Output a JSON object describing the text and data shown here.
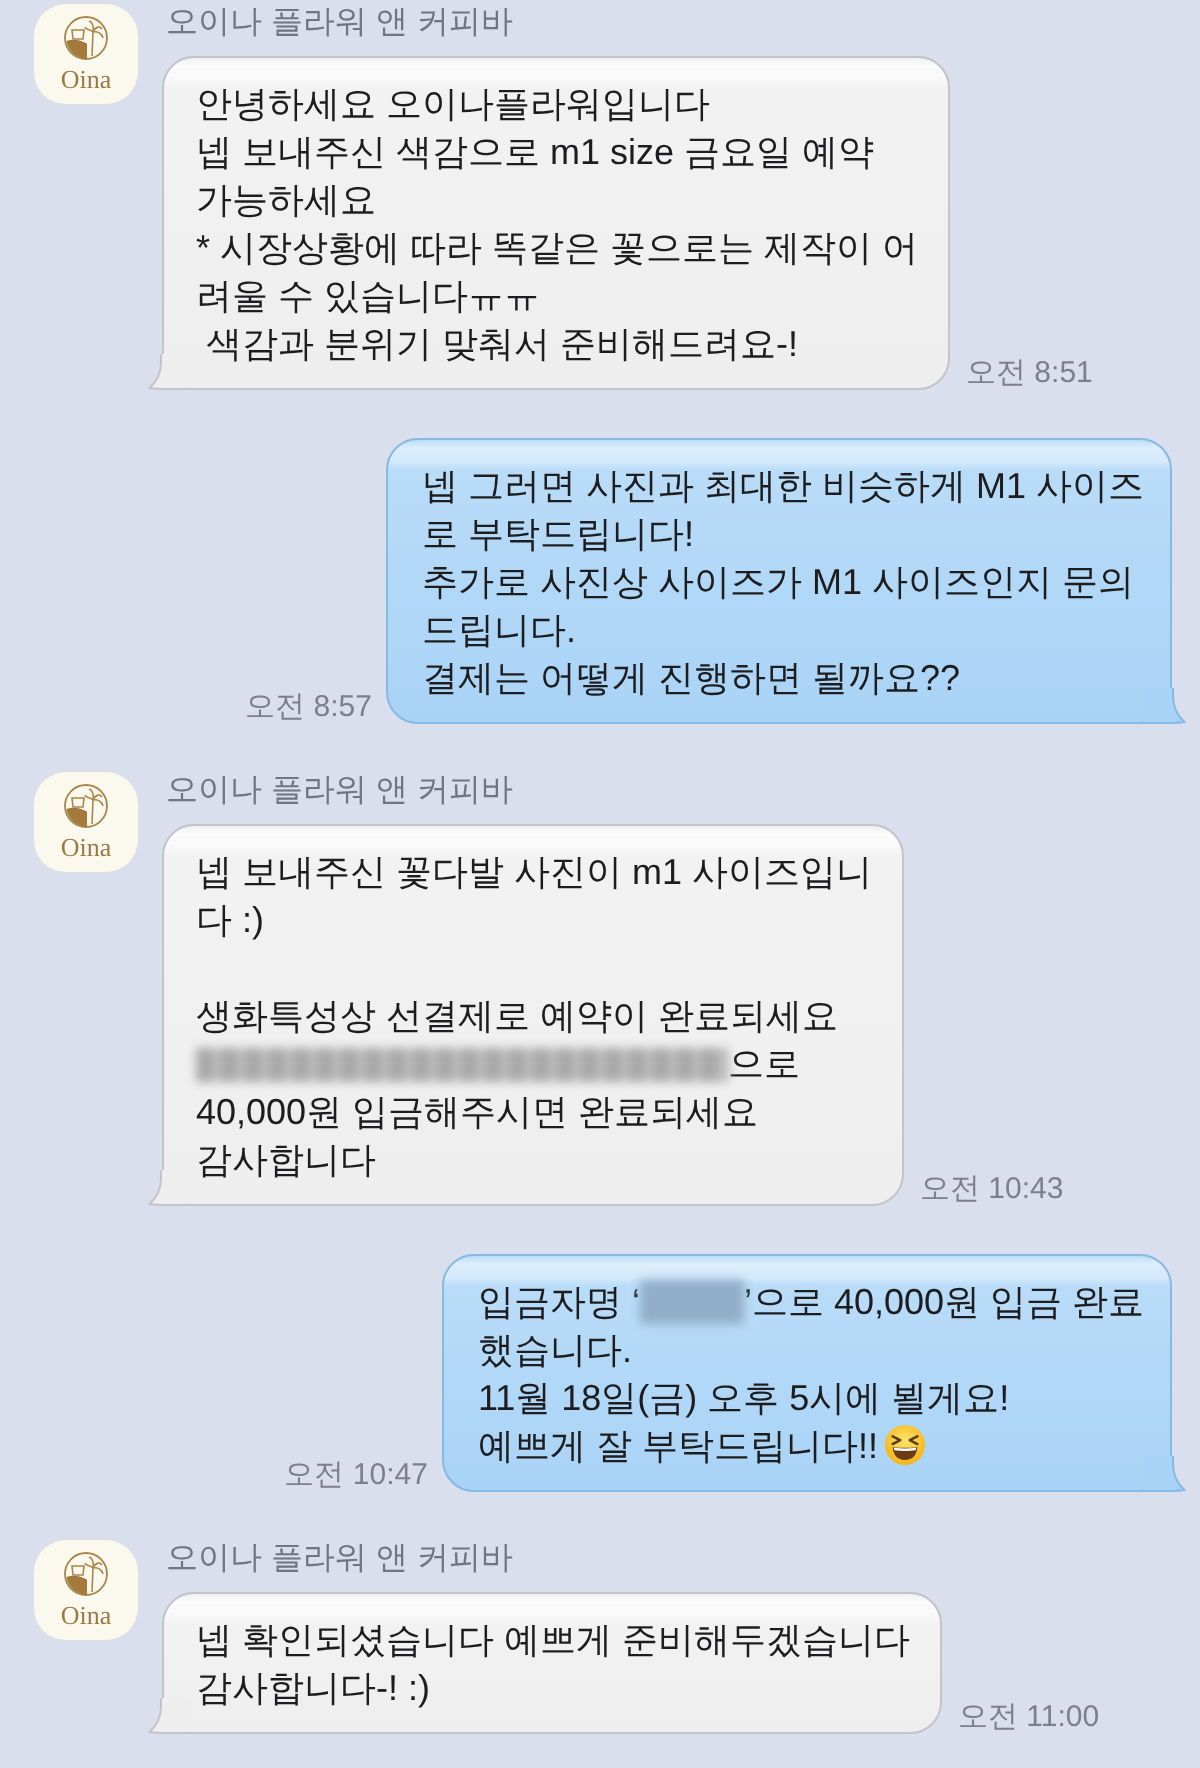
{
  "messages": [
    {
      "kind": "received",
      "sender": {
        "name": "오이나 플라워 앤 커피바",
        "avatar_text": "Oina"
      },
      "blocks": [
        {
          "parts": [
            {
              "kind": "text",
              "text": "안녕하세요 오이나플라워입니다\n넵 보내주신 색감으로 m1 size 금요일 예약\n가능하세요\n* 시장상황에 따라 똑같은 꽃으로는 제작이 어\n려울 수 있습니다ㅠㅠ\n 색감과 분위기 맞춰서 준비해드려요-!"
            }
          ]
        }
      ],
      "time": "오전 8:51"
    },
    {
      "kind": "sent",
      "blocks": [
        {
          "parts": [
            {
              "kind": "text",
              "text": "넵 그러면 사진과 최대한 비슷하게 M1 사이즈\n로 부탁드립니다!\n추가로 사진상 사이즈가 M1 사이즈인지 문의\n드립니다.\n결제는 어떻게 진행하면 될까요??"
            }
          ]
        }
      ],
      "time": "오전 8:57"
    },
    {
      "kind": "received",
      "sender": {
        "name": "오이나 플라워 앤 커피바",
        "avatar_text": "Oina"
      },
      "blocks": [
        {
          "parts": [
            {
              "kind": "text",
              "text": "넵 보내주신 꽃다발 사진이 m1 사이즈입니\n다 :)\n\n생화특성상 선결제로 예약이 완료되세요"
            }
          ]
        },
        {
          "parts": [
            {
              "kind": "account"
            },
            {
              "kind": "text",
              "text": "으로"
            }
          ]
        },
        {
          "parts": [
            {
              "kind": "text",
              "text": "40,000원 입금해주시면 완료되세요\n감사합니다"
            }
          ]
        }
      ],
      "time": "오전 10:43"
    },
    {
      "kind": "sent",
      "blocks": [
        {
          "parts": [
            {
              "kind": "text",
              "text": "입금자명 ‘"
            },
            {
              "kind": "name"
            },
            {
              "kind": "text",
              "text": "’으로 40,000원 입금 완료"
            }
          ]
        },
        {
          "parts": [
            {
              "kind": "text",
              "text": "했습니다.\n11월 18일(금) 오후 5시에 뵐게요!"
            }
          ]
        },
        {
          "parts": [
            {
              "kind": "text",
              "text": "예쁘게 잘 부탁드립니다!!"
            },
            {
              "kind": "emoji"
            }
          ]
        }
      ],
      "time": "오전 10:47"
    },
    {
      "kind": "received",
      "sender": {
        "name": "오이나 플라워 앤 커피바",
        "avatar_text": "Oina"
      },
      "blocks": [
        {
          "parts": [
            {
              "kind": "text",
              "text": "넵 확인되셨습니다 예쁘게 준비해두겠습니다\n감사합니다-! :)"
            }
          ]
        }
      ],
      "time": "오전 11:00"
    }
  ]
}
